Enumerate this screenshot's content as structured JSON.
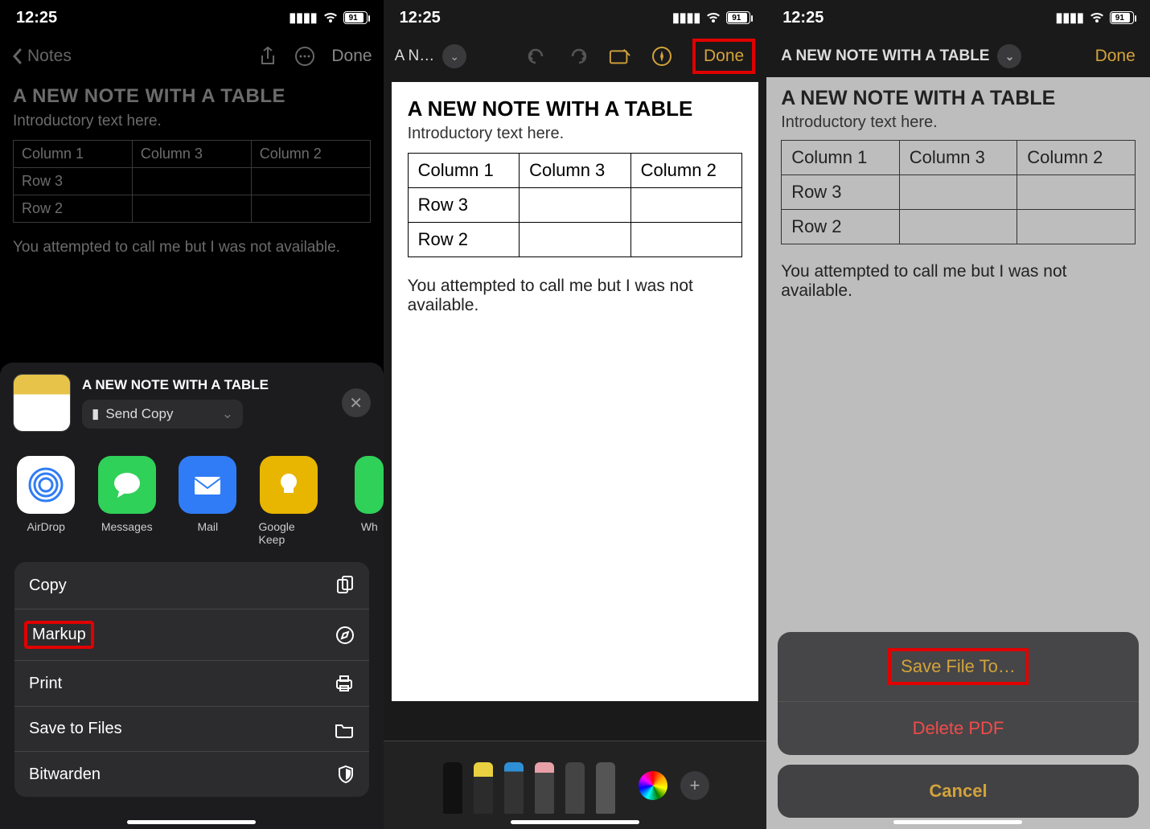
{
  "status": {
    "time": "12:25",
    "battery": "91"
  },
  "screen1": {
    "nav": {
      "back": "Notes",
      "done": "Done"
    },
    "note": {
      "title": "A NEW NOTE WITH A TABLE",
      "intro": "Introductory text here.",
      "cols": [
        "Column 1",
        "Column 3",
        "Column 2"
      ],
      "rows": [
        "Row 3",
        "Row 2"
      ],
      "body": "You attempted to call me but I was not available."
    },
    "sheet": {
      "title": "A NEW NOTE WITH A TABLE",
      "send": "Send Copy",
      "apps": [
        {
          "label": "AirDrop"
        },
        {
          "label": "Messages"
        },
        {
          "label": "Mail"
        },
        {
          "label": "Google Keep"
        },
        {
          "label": "Wh"
        }
      ],
      "actions": {
        "copy": "Copy",
        "markup": "Markup",
        "print": "Print",
        "savefiles": "Save to Files",
        "bitwarden": "Bitwarden"
      }
    }
  },
  "screen2": {
    "nav": {
      "title": "A N…",
      "done": "Done"
    },
    "note": {
      "title": "A NEW NOTE WITH A TABLE",
      "intro": "Introductory text here.",
      "cols": [
        "Column 1",
        "Column 3",
        "Column 2"
      ],
      "rows": [
        "Row 3",
        "Row 2"
      ],
      "body": "You attempted to call me but I was not available."
    }
  },
  "screen3": {
    "nav": {
      "title": "A NEW NOTE WITH A TABLE",
      "done": "Done"
    },
    "note": {
      "title": "A NEW NOTE WITH A TABLE",
      "intro": "Introductory text here.",
      "cols": [
        "Column 1",
        "Column 3",
        "Column 2"
      ],
      "rows": [
        "Row 3",
        "Row 2"
      ],
      "body": "You attempted to call me but I was not available."
    },
    "sheet": {
      "save": "Save File To…",
      "delete": "Delete PDF",
      "cancel": "Cancel"
    }
  }
}
